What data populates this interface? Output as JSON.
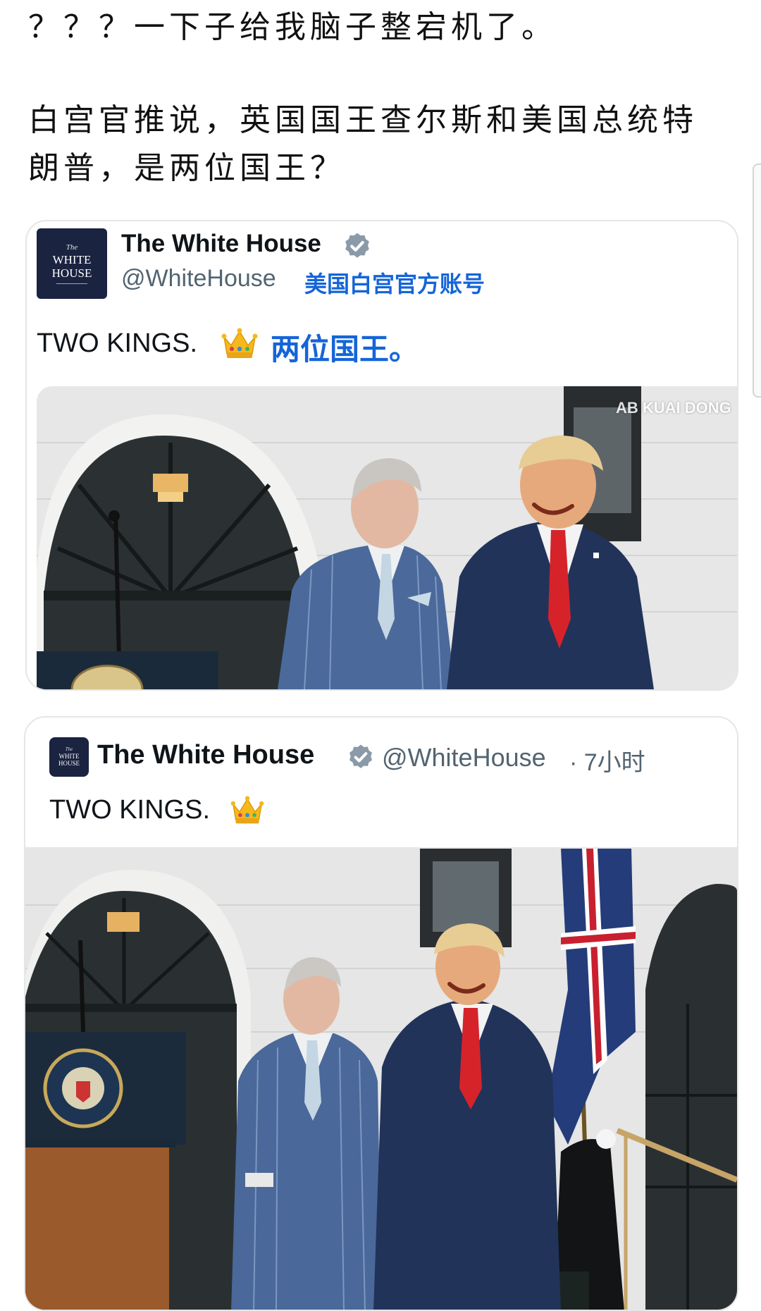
{
  "post": {
    "line1": "？？？一下子给我脑子整宕机了。",
    "line2": "白宫官推说，英国国王查尔斯和美国总统特",
    "line3": "朗普，是两位国王？"
  },
  "quoted_tweet": {
    "avatar_text": [
      "The",
      "WHITE",
      "HOUSE"
    ],
    "display_name": "The White House",
    "handle": "@WhiteHouse",
    "handle_note": "美国白宫官方账号",
    "text": "TWO KINGS.",
    "text_translation": "两位国王。",
    "image_watermark": "AB KUAI DONG",
    "verified_icon": "verified-badge-icon",
    "crown_icon": "crown-emoji"
  },
  "original_tweet": {
    "avatar_text": [
      "The",
      "WHITE",
      "HOUSE"
    ],
    "display_name": "The White House",
    "handle": "@WhiteHouse",
    "time": "· 7小时",
    "text": "TWO KINGS.",
    "verified_icon": "verified-badge-icon",
    "crown_icon": "crown-emoji"
  },
  "colors": {
    "link_blue": "#1565d8",
    "handle_gray": "#536471",
    "verified_gray": "#8a9aa8",
    "avatar_navy": "#1a2340"
  }
}
